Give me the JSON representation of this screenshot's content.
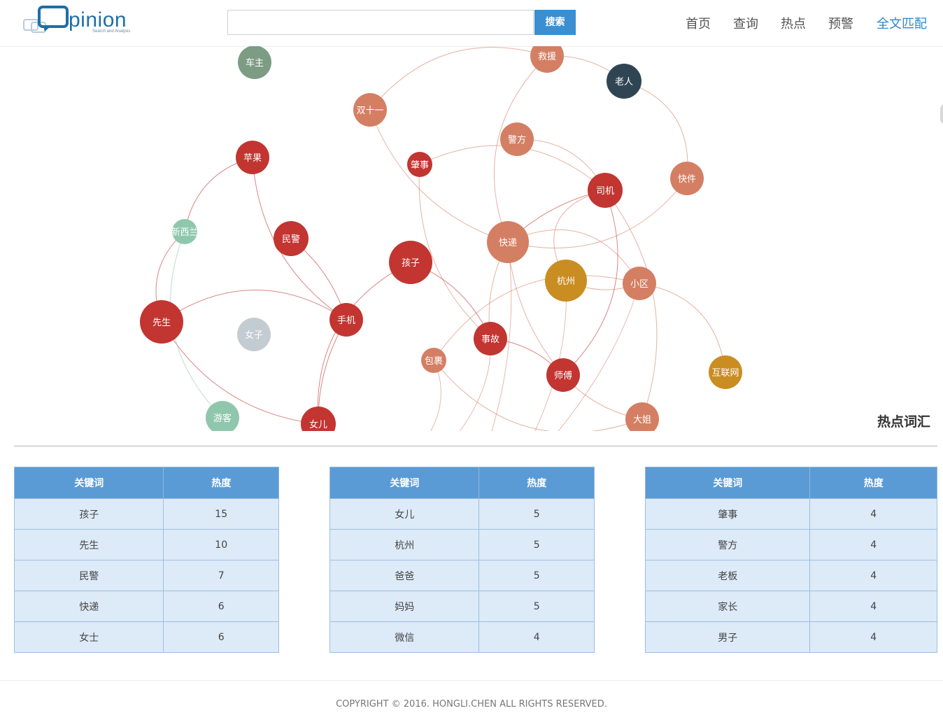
{
  "brand": {
    "name": "pinion",
    "tagline": "Search and Analysis"
  },
  "search": {
    "value": "",
    "button_label": "搜索"
  },
  "nav": {
    "items": [
      "首页",
      "查询",
      "热点",
      "预警",
      "全文匹配"
    ],
    "active_index": 4
  },
  "graph": {
    "section_title": "热点词汇",
    "colors": {
      "red": "#c23531",
      "salmon": "#d47f63",
      "navy": "#2f4554",
      "green": "#7d9c84",
      "mint": "#8fc7ad",
      "gray": "#c4ccd3",
      "gold": "#c98d22"
    },
    "nodes": [
      "车主",
      "救援",
      "老人",
      "双十一",
      "警方",
      "肇事",
      "司机",
      "快件",
      "苹果",
      "新西兰",
      "民警",
      "孩子",
      "快递",
      "杭州",
      "小区",
      "先生",
      "女子",
      "手机",
      "事故",
      "包裹",
      "师傅",
      "互联网",
      "游客",
      "女儿",
      "大姐"
    ]
  },
  "tables": {
    "header_keyword": "关键词",
    "header_heat": "热度",
    "groups": [
      [
        {
          "keyword": "孩子",
          "heat": "15"
        },
        {
          "keyword": "先生",
          "heat": "10"
        },
        {
          "keyword": "民警",
          "heat": "7"
        },
        {
          "keyword": "快递",
          "heat": "6"
        },
        {
          "keyword": "女士",
          "heat": "6"
        }
      ],
      [
        {
          "keyword": "女儿",
          "heat": "5"
        },
        {
          "keyword": "杭州",
          "heat": "5"
        },
        {
          "keyword": "爸爸",
          "heat": "5"
        },
        {
          "keyword": "妈妈",
          "heat": "5"
        },
        {
          "keyword": "微信",
          "heat": "4"
        }
      ],
      [
        {
          "keyword": "肇事",
          "heat": "4"
        },
        {
          "keyword": "警方",
          "heat": "4"
        },
        {
          "keyword": "老板",
          "heat": "4"
        },
        {
          "keyword": "家长",
          "heat": "4"
        },
        {
          "keyword": "男子",
          "heat": "4"
        }
      ]
    ]
  },
  "footer": {
    "copyright": "COPYRIGHT © 2016. HONGLI.CHEN ALL RIGHTS RESERVED."
  }
}
